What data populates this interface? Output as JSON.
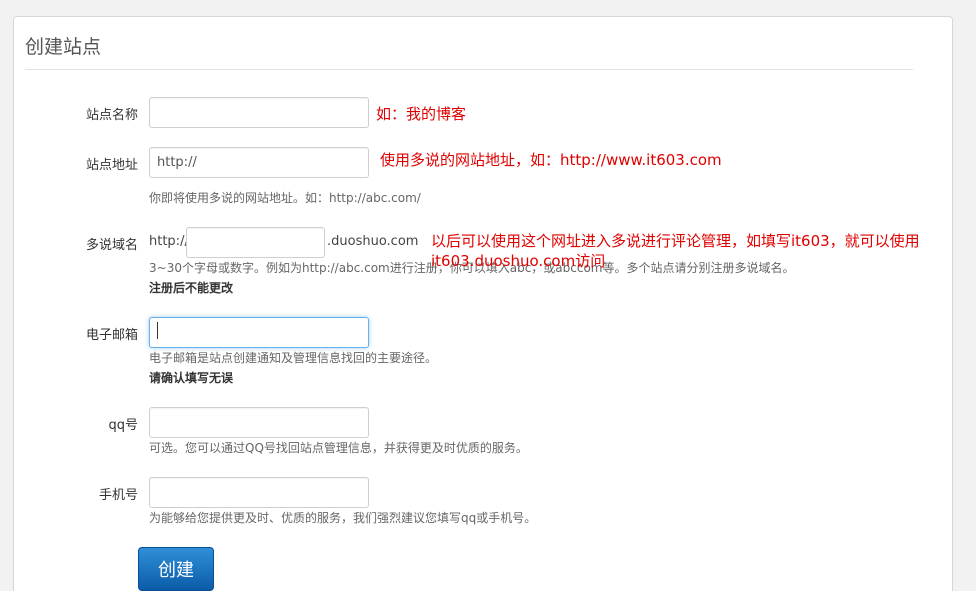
{
  "page": {
    "title": "创建站点"
  },
  "form": {
    "site_name": {
      "label": "站点名称",
      "value": "",
      "annotation": "如：我的博客"
    },
    "site_url": {
      "label": "站点地址",
      "value": "http://",
      "annotation": "使用多说的网站地址，如：http://www.it603.com",
      "help": "你即将使用多说的网站地址。如：http://abc.com/"
    },
    "duoshuo_domain": {
      "label": "多说域名",
      "prefix": "http://",
      "value": "",
      "suffix": ".duoshuo.com",
      "annotation_line1": "以后可以使用这个网址进入多说进行评论管理，如填写it603，就可以使用",
      "annotation_line2": "it603.duoshuo.com访问",
      "help": "3~30个字母或数字。例如为http://abc.com进行注册，你可以填入abc，或abccom等。多个站点请分别注册多说域名。",
      "warning": "注册后不能更改"
    },
    "email": {
      "label": "电子邮箱",
      "value": "",
      "help": "电子邮箱是站点创建通知及管理信息找回的主要途径。",
      "warning": "请确认填写无误"
    },
    "qq": {
      "label": "qq号",
      "value": "",
      "help": "可选。您可以通过QQ号找回站点管理信息，并获得更及时优质的服务。"
    },
    "phone": {
      "label": "手机号",
      "value": "",
      "help": "为能够给您提供更及时、优质的服务，我们强烈建议您填写qq或手机号。"
    },
    "submit_label": "创建"
  },
  "colors": {
    "annotation": "#e00000",
    "button": "#1a74c2",
    "focus": "#66afe9"
  }
}
